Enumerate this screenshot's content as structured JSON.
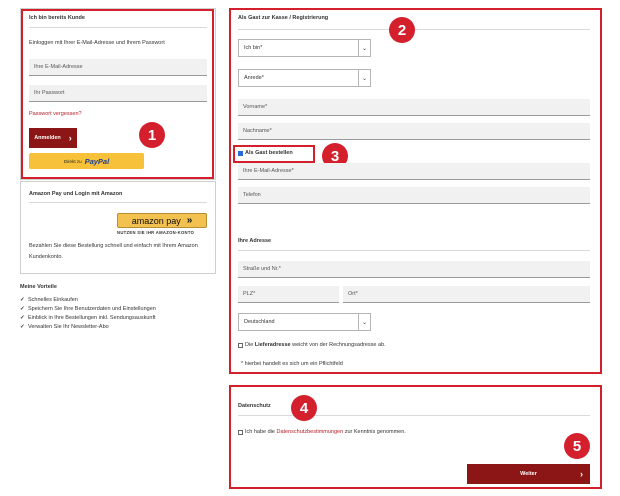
{
  "login": {
    "title": "Ich bin bereits Kunde",
    "intro": "Einloggen mit Ihrer E-Mail-Adresse und Ihrem Passwort",
    "email_placeholder": "Ihre E-Mail-Adresse",
    "password_placeholder": "Ihr Passwort",
    "forgot_link": "Passwort vergessen?",
    "login_button": "Anmelden",
    "paypal_prefix": "Direkt zu",
    "paypal_brand": "PayPal"
  },
  "amazon": {
    "title": "Amazon Pay und Login mit Amazon",
    "button_label": "amazon pay",
    "button_chevrons": "»",
    "subline": "NUTZEN SIE IHR AMAZON-KONTO",
    "description_line1": "Bezahlen Sie diese Bestellung schnell und einfach mit Ihrem Amazon",
    "description_line2": "Kundenkonto."
  },
  "benefits": {
    "title": "Meine Vorteile",
    "tick": "✓",
    "items": [
      "Schnelles Einkaufen",
      "Speichern Sie Ihre Benutzerdaten und Einstellungen",
      "Einblick in Ihre Bestellungen inkl. Sendungsauskunft",
      "Verwalten Sie Ihr Newsletter-Abo"
    ]
  },
  "guest": {
    "title": "Als Gast zur Kasse / Registrierung",
    "type_select": "Ich bin*",
    "salutation_select": "Anrede*",
    "firstname_placeholder": "Vorname*",
    "lastname_placeholder": "Nachname*",
    "guest_checkbox_label": "Als Gast bestellen",
    "email_placeholder": "Ihre E-Mail-Adresse*",
    "phone_placeholder": "Telefon",
    "address_title": "Ihre Adresse",
    "street_placeholder": "Straße und Nr.*",
    "zip_placeholder": "PLZ*",
    "city_placeholder": "Ort*",
    "country_select": "Deutschland",
    "shipping_prefix": "Die",
    "shipping_bold": "Lieferadresse",
    "shipping_suffix": "weicht von der Rechnungsadresse ab.",
    "required_note": "* hierbei handelt es sich um ein Pflichtfeld"
  },
  "privacy": {
    "title": "Datenschutz",
    "consent_prefix": "Ich habe die",
    "consent_link": "Datenschutzbestimmungen",
    "consent_suffix": "zur Kenntnis genommen.",
    "continue_button": "Weiter",
    "continue_arrow": "›"
  },
  "annotations": {
    "b1": "1",
    "b2": "2",
    "b3": "3",
    "b4": "4",
    "b5": "5"
  },
  "icons": {
    "chevron_right": "›",
    "chevron_down": "⌄"
  },
  "colors": {
    "brand_red": "#8c1515",
    "annotation_red": "#d4202c",
    "paypal_yellow": "#f7c23a",
    "amazon_yellow": "#f3c14f",
    "link_red": "#b3202a"
  }
}
